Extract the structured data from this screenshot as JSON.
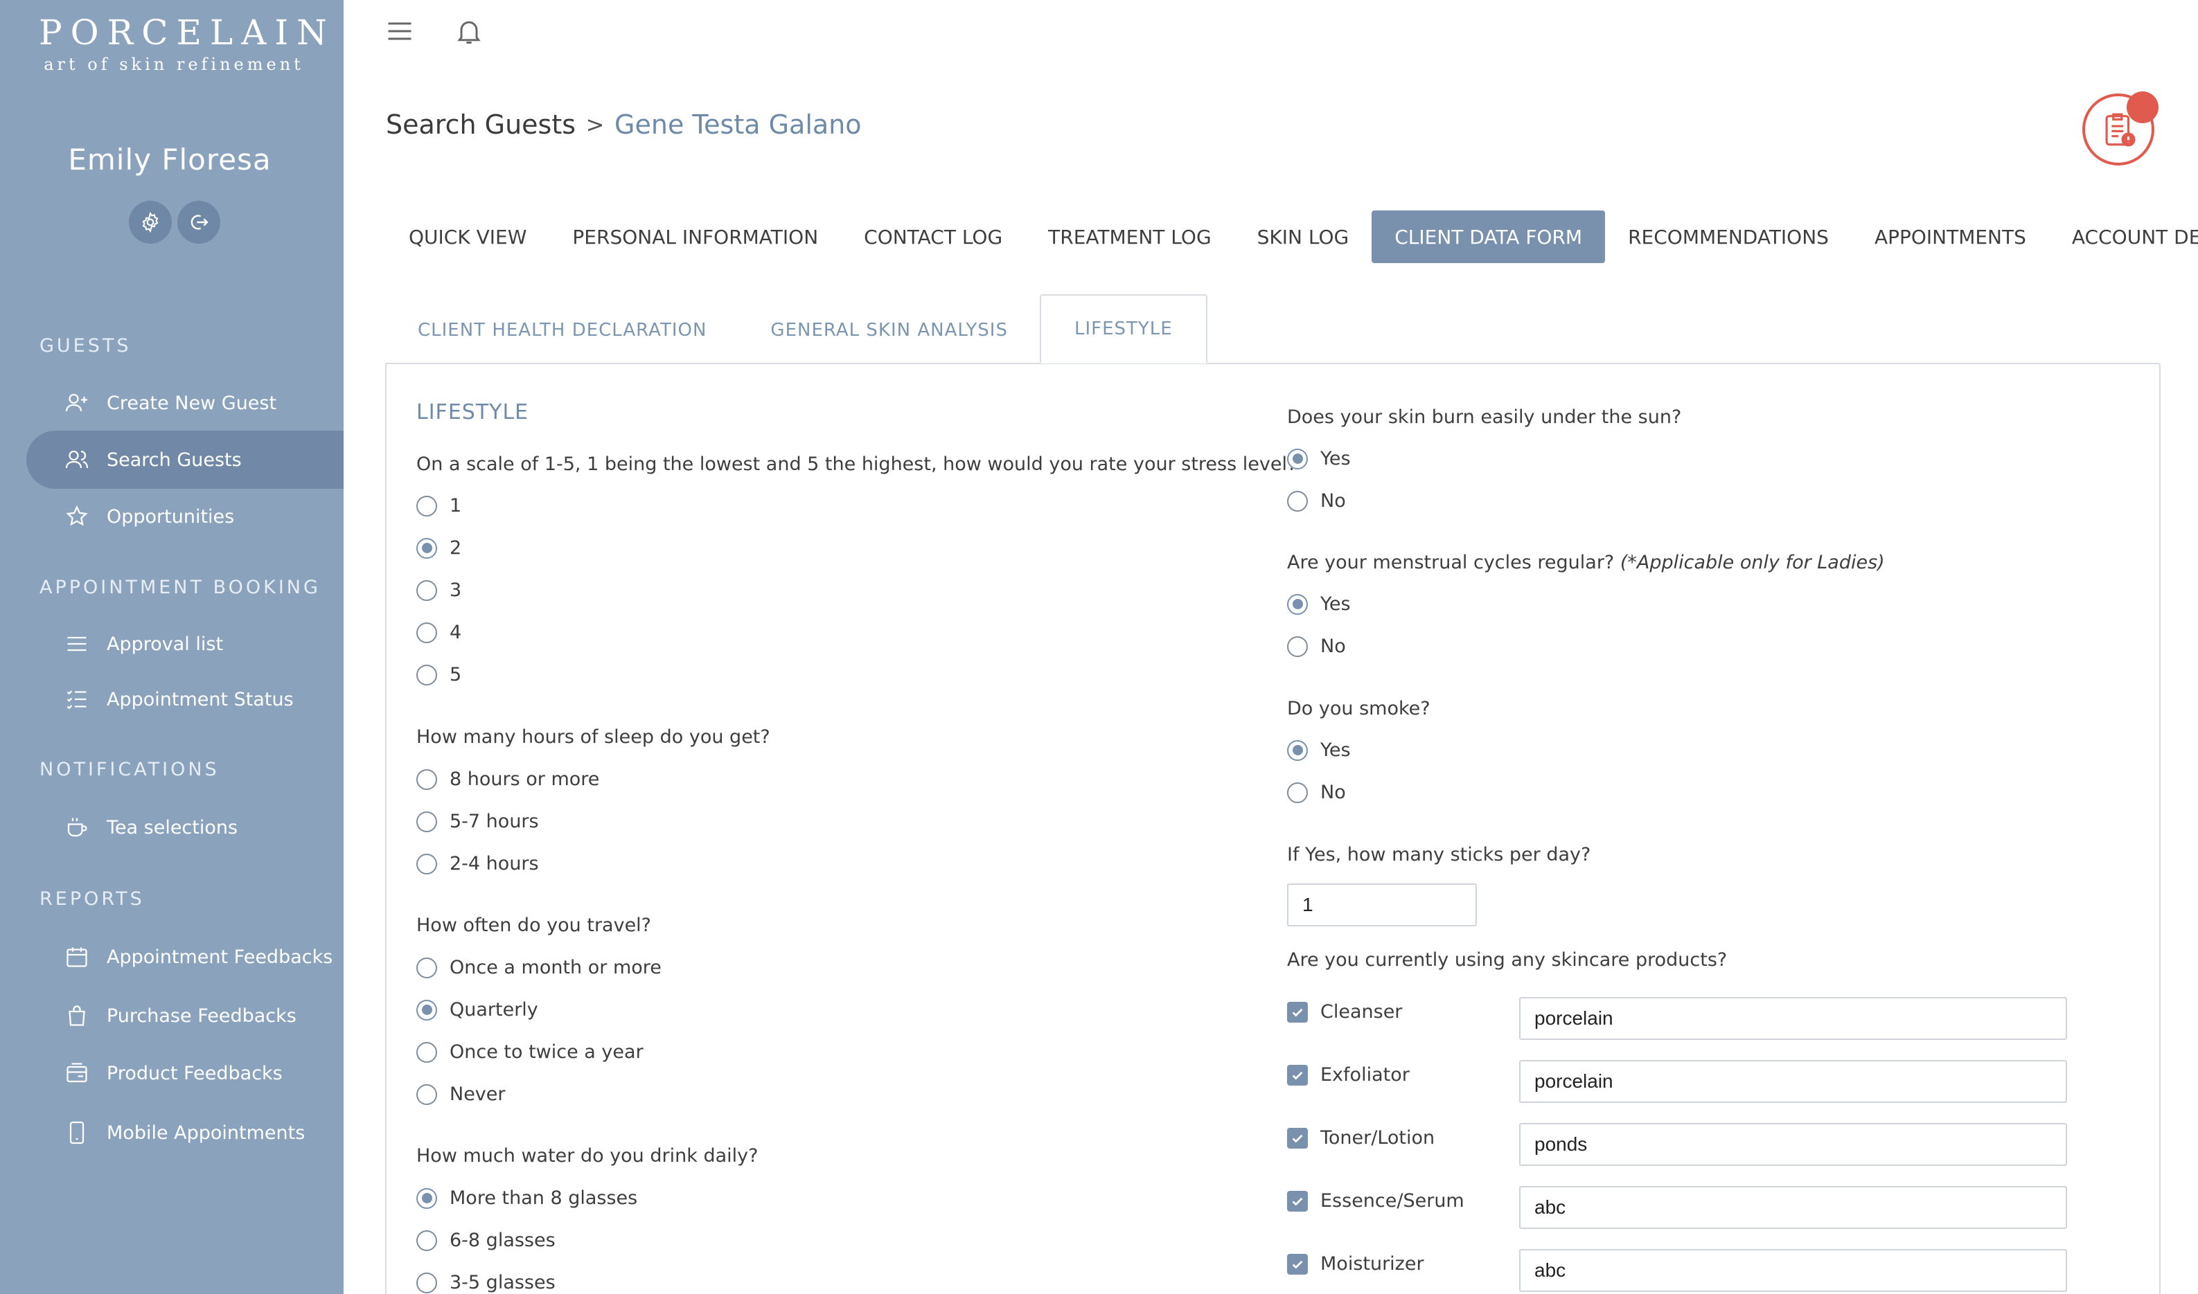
{
  "brand": {
    "name": "PORCELAIN",
    "tagline": "art of skin refinement"
  },
  "user": {
    "name": "Emily Floresa",
    "actions": [
      {
        "icon": "gear-icon"
      },
      {
        "icon": "logout-icon"
      }
    ]
  },
  "sidebar": {
    "sections": [
      {
        "title": "GUESTS",
        "items": [
          {
            "label": "Create New Guest",
            "icon": "user-add-icon"
          },
          {
            "label": "Search Guests",
            "icon": "users-icon",
            "active": true
          },
          {
            "label": "Opportunities",
            "icon": "star-icon"
          }
        ]
      },
      {
        "title": "APPOINTMENT BOOKING",
        "items": [
          {
            "label": "Approval list",
            "icon": "list-icon"
          },
          {
            "label": "Appointment Status",
            "icon": "checklist-icon"
          }
        ]
      },
      {
        "title": "NOTIFICATIONS",
        "items": [
          {
            "label": "Tea selections",
            "icon": "cup-icon"
          }
        ]
      },
      {
        "title": "REPORTS",
        "items": [
          {
            "label": "Appointment Feedbacks",
            "icon": "calendar-icon"
          },
          {
            "label": "Purchase Feedbacks",
            "icon": "shopping-bag-icon"
          },
          {
            "label": "Product Feedbacks",
            "icon": "product-icon"
          },
          {
            "label": "Mobile Appointments",
            "icon": "mobile-icon"
          }
        ]
      }
    ]
  },
  "topbar": {
    "menu_icon": "hamburger-icon",
    "bell_icon": "bell-icon",
    "alert_icon": "clipboard-alert-icon"
  },
  "breadcrumb": {
    "root": "Search Guests",
    "separator": ">",
    "current": "Gene Testa Galano"
  },
  "main_tabs": [
    {
      "label": "QUICK VIEW"
    },
    {
      "label": "PERSONAL INFORMATION"
    },
    {
      "label": "CONTACT LOG"
    },
    {
      "label": "TREATMENT LOG"
    },
    {
      "label": "SKIN LOG"
    },
    {
      "label": "CLIENT DATA FORM",
      "active": true
    },
    {
      "label": "RECOMMENDATIONS"
    },
    {
      "label": "APPOINTMENTS"
    },
    {
      "label": "ACCOUNT DETAILS"
    }
  ],
  "sub_tabs": [
    {
      "label": "CLIENT HEALTH DECLARATION"
    },
    {
      "label": "GENERAL SKIN ANALYSIS"
    },
    {
      "label": "LIFESTYLE",
      "active": true
    }
  ],
  "form": {
    "title": "LIFESTYLE",
    "stress": {
      "question": "On a scale of 1-5, 1 being the lowest and 5 the highest, how would you rate your stress level?",
      "options": [
        "1",
        "2",
        "3",
        "4",
        "5"
      ],
      "selected": "2"
    },
    "sleep": {
      "question": "How many hours of sleep do you get?",
      "options": [
        "8 hours or more",
        "5-7 hours",
        "2-4 hours"
      ],
      "selected": ""
    },
    "travel": {
      "question": "How often do you travel?",
      "options": [
        "Once a month or more",
        "Quarterly",
        "Once to twice a year",
        "Never"
      ],
      "selected": "Quarterly"
    },
    "water": {
      "question": "How much water do you drink daily?",
      "options": [
        "More than 8 glasses",
        "6-8 glasses",
        "3-5 glasses"
      ],
      "selected": "More than 8 glasses"
    },
    "sunburn": {
      "question": "Does your skin burn easily under the sun?",
      "options": [
        "Yes",
        "No"
      ],
      "selected": "Yes"
    },
    "menstrual": {
      "question": "Are your menstrual cycles regular?",
      "note": "(*Applicable only for Ladies)",
      "options": [
        "Yes",
        "No"
      ],
      "selected": "Yes"
    },
    "smoke": {
      "question": "Do you smoke?",
      "options": [
        "Yes",
        "No"
      ],
      "selected": "Yes"
    },
    "sticks": {
      "question": "If Yes, how many sticks per day?",
      "value": "1"
    },
    "skincare": {
      "question": "Are you currently using any skincare products?",
      "products": [
        {
          "label": "Cleanser",
          "checked": true,
          "value": "porcelain"
        },
        {
          "label": "Exfoliator",
          "checked": true,
          "value": "porcelain"
        },
        {
          "label": "Toner/Lotion",
          "checked": true,
          "value": "ponds"
        },
        {
          "label": "Essence/Serum",
          "checked": true,
          "value": "abc"
        },
        {
          "label": "Moisturizer",
          "checked": true,
          "value": "abc"
        }
      ]
    }
  },
  "colors": {
    "sidebar": "#8aa2bc",
    "accent": "#7991ad",
    "alert": "#e05a4e",
    "link": "#6e8aa8"
  }
}
